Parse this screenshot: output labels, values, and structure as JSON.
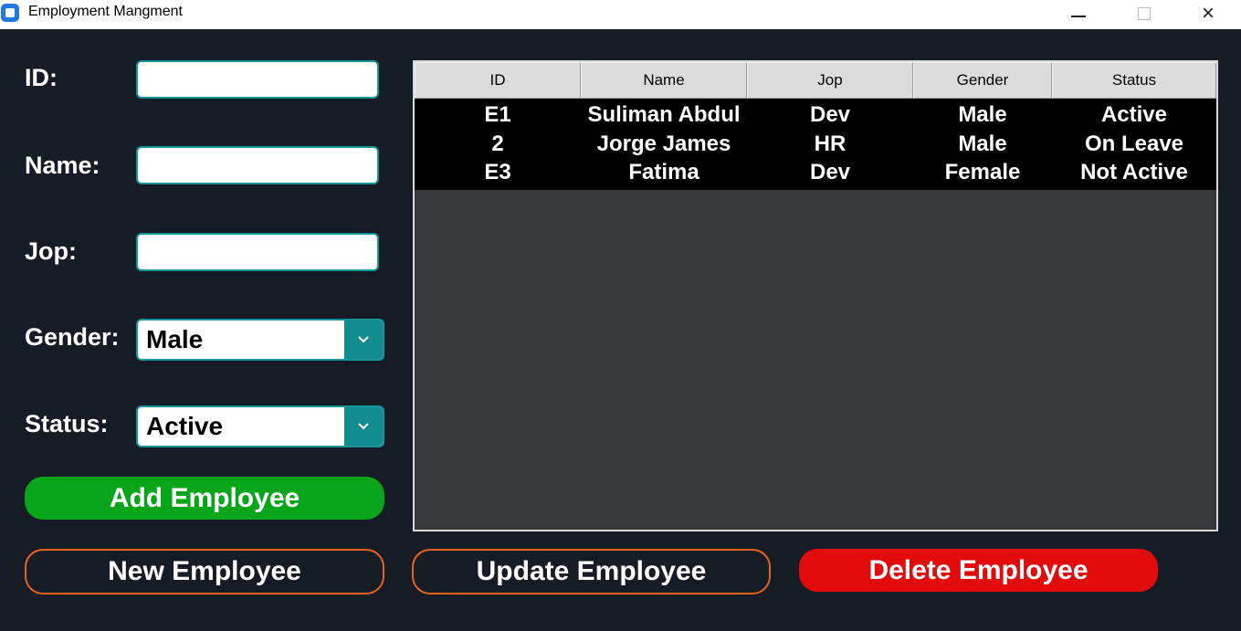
{
  "window": {
    "title": "Employment Mangment",
    "controls": {
      "minimize": "minimize-icon",
      "maximize": "maximize-icon",
      "close": "×"
    }
  },
  "form": {
    "id_label": "ID:",
    "name_label": "Name:",
    "jop_label": "Jop:",
    "gender_label": "Gender:",
    "status_label": "Status:",
    "id_value": "",
    "name_value": "",
    "jop_value": "",
    "gender_value": "Male",
    "status_value": "Active"
  },
  "buttons": {
    "add": "Add Employee",
    "new": "New Employee",
    "update": "Update Employee",
    "delete": "Delete Employee"
  },
  "table": {
    "columns": [
      "ID",
      "Name",
      "Jop",
      "Gender",
      "Status"
    ],
    "rows": [
      [
        "E1",
        "Suliman Abdul",
        "Dev",
        "Male",
        "Active"
      ],
      [
        "2",
        "Jorge James",
        "HR",
        "Male",
        "On Leave"
      ],
      [
        "E3",
        "Fatima",
        "Dev",
        "Female",
        "Not Active"
      ]
    ]
  },
  "colors": {
    "background": "#161c26",
    "field_border": "#139598",
    "add_button": "#06a51a",
    "outline_button": "#e8641c",
    "delete_button": "#e20a0a",
    "table_body": "#343a39"
  }
}
